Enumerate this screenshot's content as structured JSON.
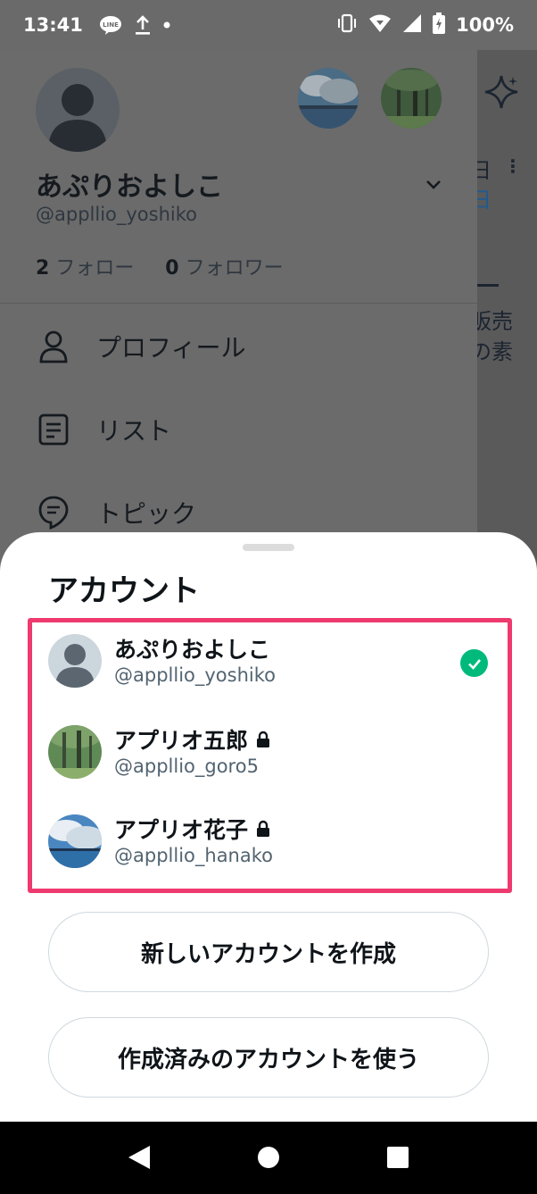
{
  "status_bar": {
    "time": "13:41",
    "line_badge": "LINE",
    "battery": "100%"
  },
  "drawer": {
    "display_name": "あぷりおよしこ",
    "handle": "@appllio_yoshiko",
    "following_count": "2",
    "following_label": "フォロー",
    "followers_count": "0",
    "followers_label": "フォロワー",
    "menu": [
      {
        "label": "プロフィール",
        "icon": "person-icon"
      },
      {
        "label": "リスト",
        "icon": "list-icon"
      },
      {
        "label": "トピック",
        "icon": "topic-icon"
      }
    ]
  },
  "background_timeline": {
    "line1": "日",
    "line2": "日",
    "line3": "販売",
    "line4": "の素"
  },
  "sheet": {
    "title": "アカウント",
    "accounts": [
      {
        "name": "あぷりおよしこ",
        "handle": "@appllio_yoshiko",
        "locked": false,
        "active": true
      },
      {
        "name": "アプリオ五郎",
        "handle": "@appllio_goro5",
        "locked": true,
        "active": false
      },
      {
        "name": "アプリオ花子",
        "handle": "@appllio_hanako",
        "locked": true,
        "active": false
      }
    ],
    "create_button": "新しいアカウントを作成",
    "existing_button": "作成済みのアカウントを使う"
  },
  "colors": {
    "highlight": "#ee3a6e",
    "check": "#00ba7c"
  }
}
